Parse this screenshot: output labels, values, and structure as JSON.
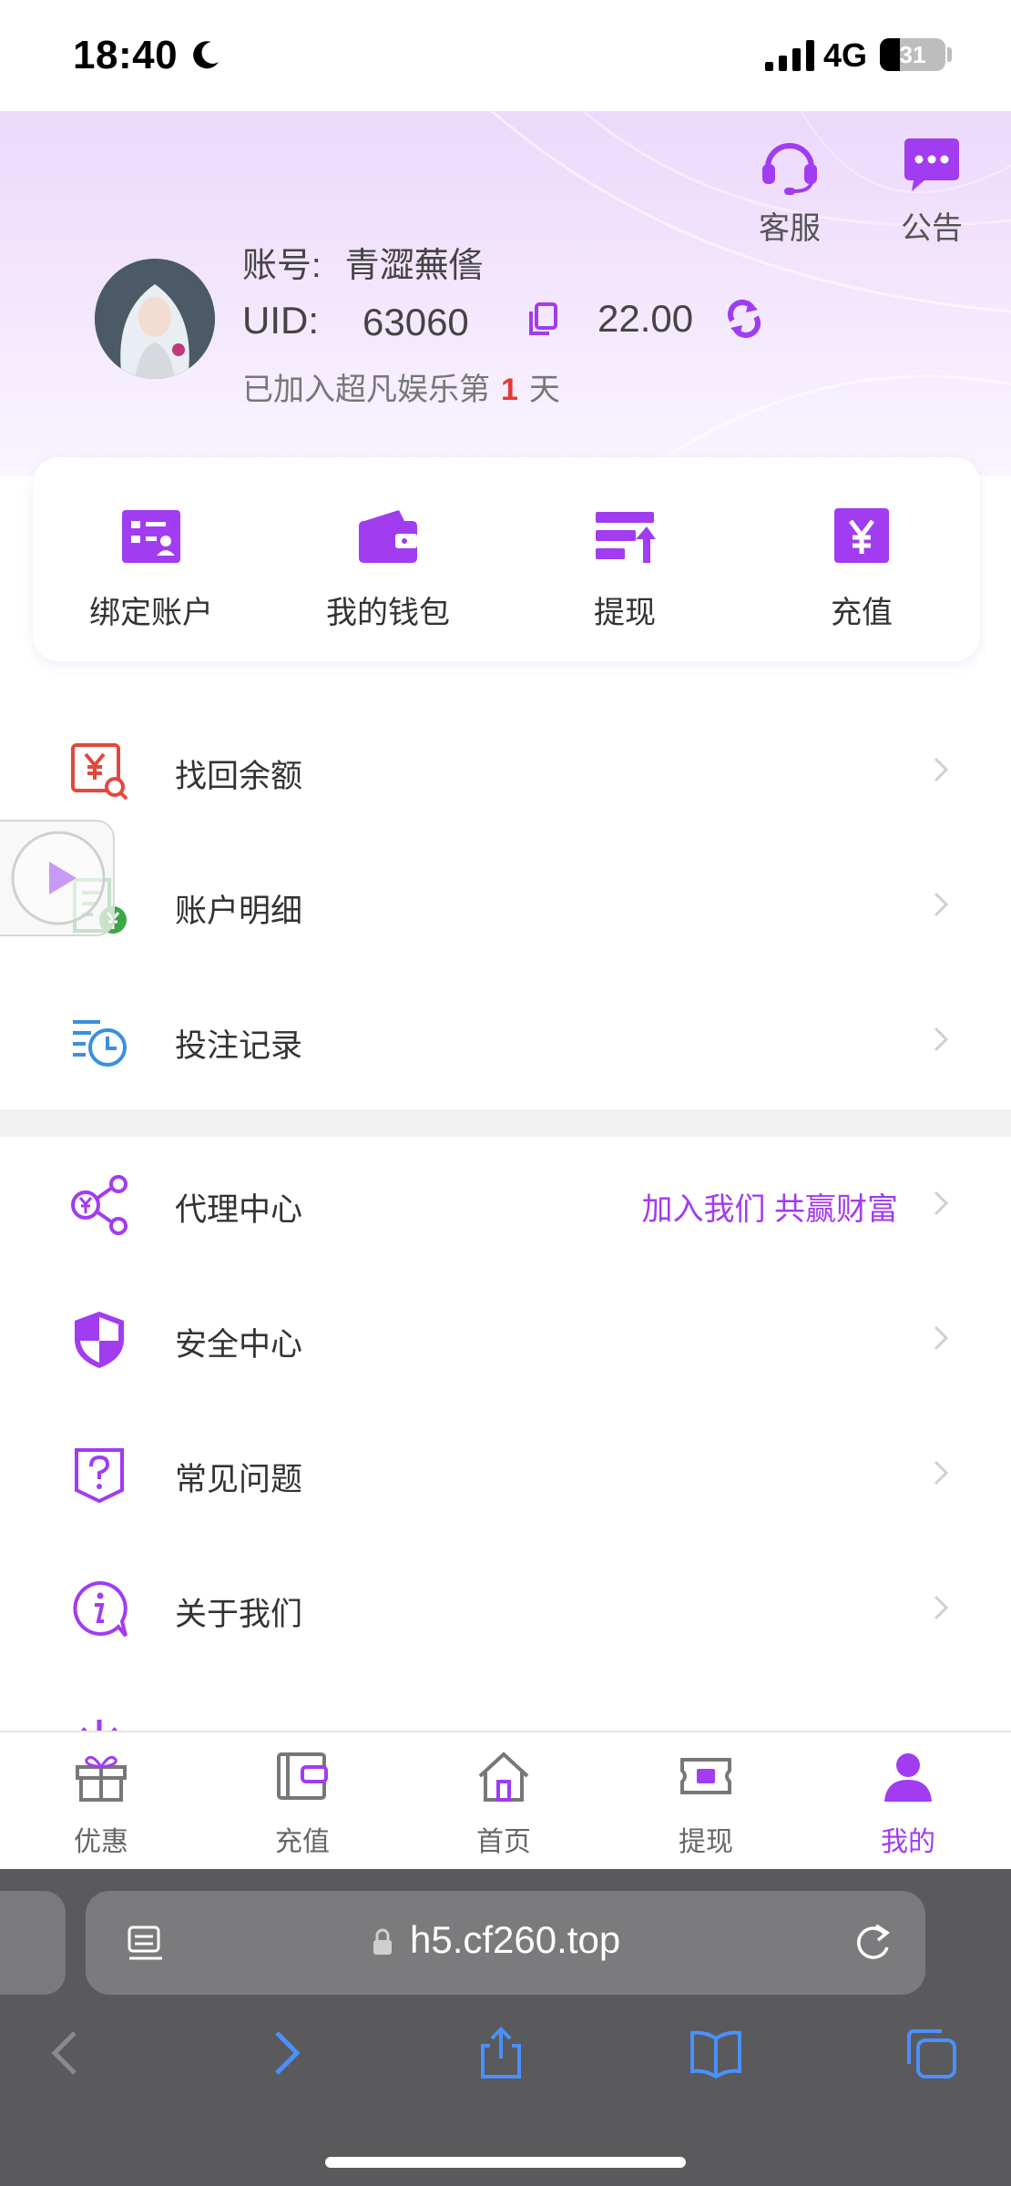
{
  "status_bar": {
    "time": "18:40",
    "network": "4G",
    "battery": "31"
  },
  "header": {
    "service_label": "客服",
    "notice_label": "公告",
    "account_label": "账号:",
    "account_value": "青澀蕪㑾",
    "uid_label": "UID:",
    "uid_value": "63060",
    "balance": "22.00",
    "joined_prefix": "已加入超凡娱乐第",
    "joined_days": "1",
    "joined_suffix": "天"
  },
  "quick_actions": [
    {
      "label": "绑定账户",
      "icon": "bind-account-icon"
    },
    {
      "label": "我的钱包",
      "icon": "wallet-icon"
    },
    {
      "label": "提现",
      "icon": "withdraw-icon"
    },
    {
      "label": "充值",
      "icon": "recharge-yen-icon"
    }
  ],
  "menu_group_1": [
    {
      "label": "找回余额",
      "icon": "recover-balance-icon"
    },
    {
      "label": "账户明细",
      "icon": "account-details-icon"
    },
    {
      "label": "投注记录",
      "icon": "bet-records-icon"
    }
  ],
  "menu_group_2": [
    {
      "label": "代理中心",
      "extra": "加入我们 共赢财富",
      "icon": "agent-share-icon"
    },
    {
      "label": "安全中心",
      "icon": "security-shield-icon"
    },
    {
      "label": "常见问题",
      "icon": "faq-icon"
    },
    {
      "label": "关于我们",
      "icon": "about-info-icon"
    }
  ],
  "tabs": [
    {
      "label": "优惠",
      "icon": "gift-icon"
    },
    {
      "label": "充值",
      "icon": "wallet-card-icon"
    },
    {
      "label": "首页",
      "icon": "home-icon"
    },
    {
      "label": "提现",
      "icon": "withdraw-ticket-icon"
    },
    {
      "label": "我的",
      "icon": "user-icon",
      "active": true
    }
  ],
  "browser": {
    "url": "h5.cf260.top"
  },
  "colors": {
    "accent": "#a13cf0",
    "days_red": "#e53935",
    "header_bg": "#ecd9fb"
  }
}
